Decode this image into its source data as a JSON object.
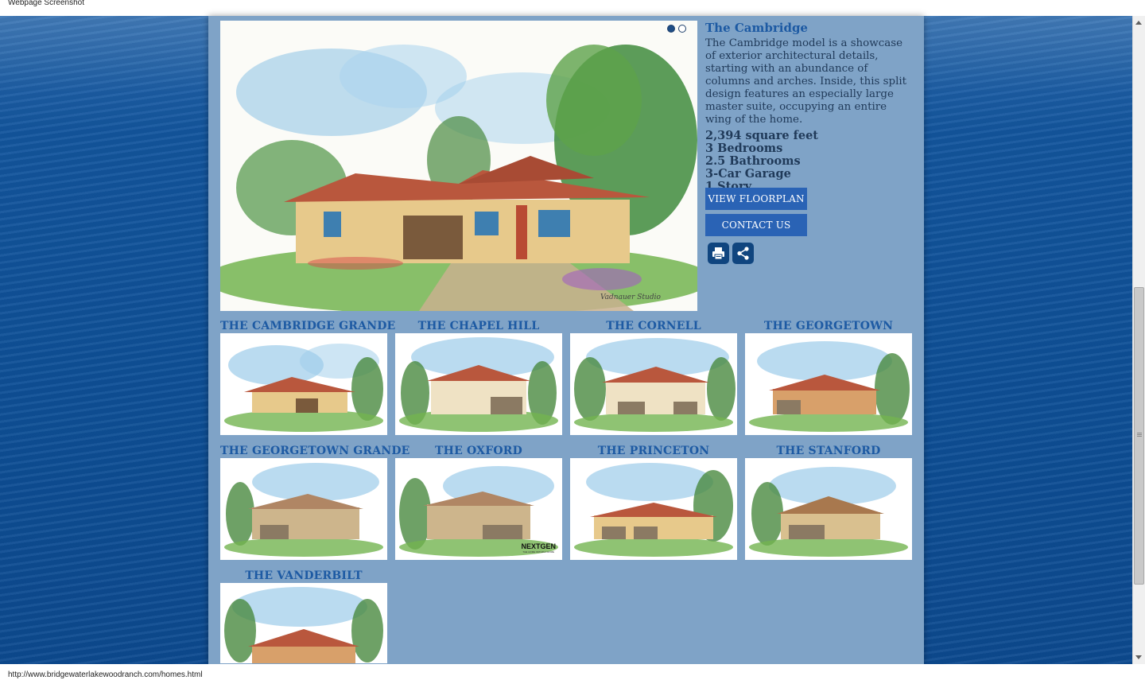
{
  "window": {
    "caption": "Webpage Screenshot"
  },
  "slideshow": {
    "slide_count": 2,
    "active_slide": 1,
    "artist_signature": "Vadnauer Studio"
  },
  "model": {
    "title": "The Cambridge",
    "description": "The Cambridge model is a showcase of exterior architectural details, starting with an abundance of columns and arches. Inside, this split design features an especially large master suite, occupying an entire wing of the home.",
    "specs": [
      "2,394 square feet",
      "3 Bedrooms",
      "2.5 Bathrooms",
      "3-Car Garage",
      "1 Story"
    ]
  },
  "buttons": {
    "floorplan": "VIEW FLOORPLAN",
    "contact": "CONTACT US",
    "print_icon": "printer-icon",
    "share_icon": "share-icon"
  },
  "homes": [
    {
      "label": "THE CAMBRIDGE GRANDE"
    },
    {
      "label": "THE CHAPEL HILL"
    },
    {
      "label": "THE CORNELL"
    },
    {
      "label": "THE GEORGETOWN"
    },
    {
      "label": "THE GEORGETOWN GRANDE"
    },
    {
      "label": "THE OXFORD",
      "badge": "NEXTGEN",
      "badge_sub": "THE HOME WITHIN A HOME"
    },
    {
      "label": "THE PRINCETON"
    },
    {
      "label": "THE STANFORD"
    },
    {
      "label": "THE VANDERBILT"
    }
  ],
  "status": {
    "url": "http://www.bridgewaterlakewoodranch.com/homes.html"
  },
  "colors": {
    "ocean": "#0e4f96",
    "panel": "#7fa3c7",
    "accent": "#2a63b5",
    "title": "#1d5aa3",
    "text": "#203a59"
  }
}
